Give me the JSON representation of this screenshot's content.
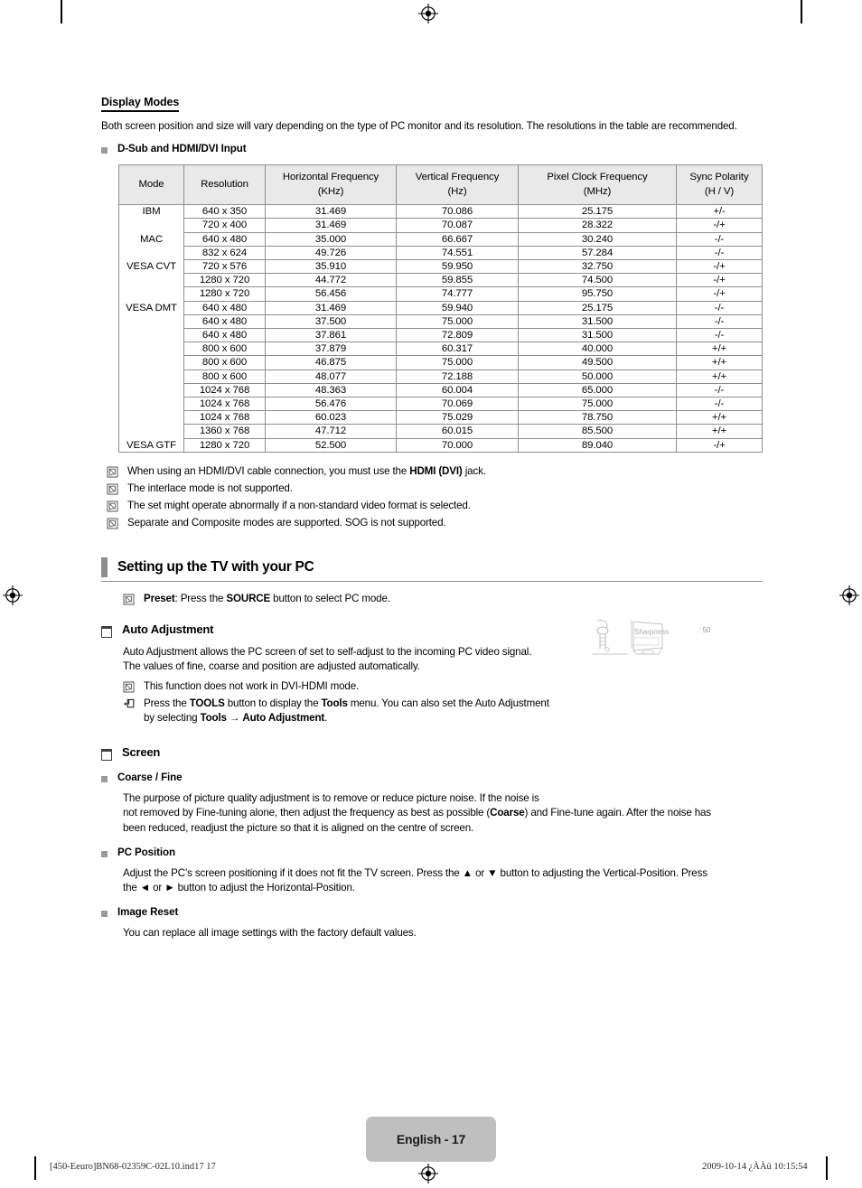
{
  "document": {
    "section_title": "Display Modes",
    "intro": "Both screen position and size will vary depending on the type of PC monitor and its resolution. The resolutions in the table are recommended.",
    "subsection_label": "D-Sub and HDMI/DVI Input"
  },
  "table": {
    "headers": [
      {
        "line1": "Mode",
        "line2": ""
      },
      {
        "line1": "Resolution",
        "line2": ""
      },
      {
        "line1": "Horizontal Frequency",
        "line2": "(KHz)"
      },
      {
        "line1": "Vertical Frequency",
        "line2": "(Hz)"
      },
      {
        "line1": "Pixel Clock Frequency",
        "line2": "(MHz)"
      },
      {
        "line1": "Sync Polarity",
        "line2": "(H / V)"
      }
    ],
    "rows": [
      {
        "mode": "IBM",
        "resolution": "640 x 350",
        "hfreq": "31.469",
        "vfreq": "70.086",
        "pclock": "25.175",
        "sync": "+/-",
        "group_start": true
      },
      {
        "mode": "",
        "resolution": "720 x 400",
        "hfreq": "31.469",
        "vfreq": "70.087",
        "pclock": "28.322",
        "sync": "-/+",
        "group_start": false
      },
      {
        "mode": "MAC",
        "resolution": "640 x 480",
        "hfreq": "35.000",
        "vfreq": "66.667",
        "pclock": "30.240",
        "sync": "-/-",
        "group_start": true
      },
      {
        "mode": "",
        "resolution": "832 x 624",
        "hfreq": "49.726",
        "vfreq": "74.551",
        "pclock": "57.284",
        "sync": "-/-",
        "group_start": false
      },
      {
        "mode": "VESA CVT",
        "resolution": "720 x 576",
        "hfreq": "35.910",
        "vfreq": "59.950",
        "pclock": "32.750",
        "sync": "-/+",
        "group_start": true
      },
      {
        "mode": "",
        "resolution": "1280 x 720",
        "hfreq": "44.772",
        "vfreq": "59.855",
        "pclock": "74.500",
        "sync": "-/+",
        "group_start": false
      },
      {
        "mode": "",
        "resolution": "1280 x 720",
        "hfreq": "56.456",
        "vfreq": "74.777",
        "pclock": "95.750",
        "sync": "-/+",
        "group_start": false
      },
      {
        "mode": "VESA DMT",
        "resolution": "640 x 480",
        "hfreq": "31.469",
        "vfreq": "59.940",
        "pclock": "25.175",
        "sync": "-/-",
        "group_start": true
      },
      {
        "mode": "",
        "resolution": "640 x 480",
        "hfreq": "37.500",
        "vfreq": "75.000",
        "pclock": "31.500",
        "sync": "-/-",
        "group_start": false
      },
      {
        "mode": "",
        "resolution": "640 x 480",
        "hfreq": "37.861",
        "vfreq": "72.809",
        "pclock": "31.500",
        "sync": "-/-",
        "group_start": false
      },
      {
        "mode": "",
        "resolution": "800 x 600",
        "hfreq": "37.879",
        "vfreq": "60.317",
        "pclock": "40.000",
        "sync": "+/+",
        "group_start": false
      },
      {
        "mode": "",
        "resolution": "800 x 600",
        "hfreq": "46.875",
        "vfreq": "75.000",
        "pclock": "49.500",
        "sync": "+/+",
        "group_start": false
      },
      {
        "mode": "",
        "resolution": "800 x 600",
        "hfreq": "48.077",
        "vfreq": "72.188",
        "pclock": "50.000",
        "sync": "+/+",
        "group_start": false
      },
      {
        "mode": "",
        "resolution": "1024 x 768",
        "hfreq": "48.363",
        "vfreq": "60.004",
        "pclock": "65.000",
        "sync": "-/-",
        "group_start": false
      },
      {
        "mode": "",
        "resolution": "1024 x 768",
        "hfreq": "56.476",
        "vfreq": "70.069",
        "pclock": "75.000",
        "sync": "-/-",
        "group_start": false
      },
      {
        "mode": "",
        "resolution": "1024 x 768",
        "hfreq": "60.023",
        "vfreq": "75.029",
        "pclock": "78.750",
        "sync": "+/+",
        "group_start": false
      },
      {
        "mode": "",
        "resolution": "1360 x 768",
        "hfreq": "47.712",
        "vfreq": "60.015",
        "pclock": "85.500",
        "sync": "+/+",
        "group_start": false
      },
      {
        "mode": "VESA GTF",
        "resolution": "1280 x 720",
        "hfreq": "52.500",
        "vfreq": "70.000",
        "pclock": "89.040",
        "sync": "-/+",
        "group_start": true
      }
    ]
  },
  "notes_after_table": [
    {
      "icon": "note-icon",
      "pre": "When using an HDMI/DVI cable connection, you must use the ",
      "bold": "HDMI (DVI)",
      "post": " jack."
    },
    {
      "icon": "note-icon",
      "pre": "The interlace mode is not supported.",
      "bold": "",
      "post": ""
    },
    {
      "icon": "note-icon",
      "pre": "The set might operate abnormally if a non-standard video format is selected.",
      "bold": "",
      "post": ""
    },
    {
      "icon": "note-icon",
      "pre": "Separate and Composite modes are supported. SOG is not supported.",
      "bold": "",
      "post": ""
    }
  ],
  "setup_section": {
    "title": "Setting up the TV with your PC",
    "preset_note": {
      "icon": "note-icon",
      "bold_lead": "Preset",
      "rest_pre": ": Press the ",
      "bold_mid": "SOURCE",
      "rest_post": " button to select PC mode."
    }
  },
  "auto_adjustment": {
    "heading": "Auto Adjustment",
    "body_line1": "Auto Adjustment allows the PC screen of set to self-adjust to the incoming PC video signal.",
    "body_line2": "The values of fine, coarse and position are adjusted automatically.",
    "note1": {
      "icon": "note-icon",
      "text": "This function does not work in DVI-HDMI mode."
    },
    "note2": {
      "icon": "tools-icon",
      "p1": "Press the ",
      "b1": "TOOLS",
      "p2": " button to display the ",
      "b2": "Tools",
      "p3": " menu. You can also set the Auto Adjustment",
      "p4": "by selecting ",
      "b3": "Tools",
      "p5": " → ",
      "b4": "Auto Adjustment",
      "p6": "."
    },
    "illustration": {
      "menu_label": "Sharpness",
      "menu_value": ": 50"
    }
  },
  "screen_section": {
    "heading": "Screen",
    "items": [
      {
        "label": "Coarse / Fine",
        "lines": [
          {
            "pre": "The purpose of picture quality adjustment is to remove or reduce picture noise. If the noise is",
            "bold": "",
            "post": ""
          },
          {
            "pre": "not removed by Fine-tuning alone, then adjust the frequency as best as possible (",
            "bold": "Coarse",
            "post": ") and Fine-tune again. After the noise has"
          },
          {
            "pre": "been reduced, readjust the picture so that it is aligned on the centre of screen.",
            "bold": "",
            "post": ""
          }
        ]
      },
      {
        "label": "PC Position",
        "lines": [
          {
            "pre": "Adjust the PC’s screen positioning if it does not fit the TV screen. Press the ▲ or ▼ button to adjusting the Vertical-Position. Press",
            "bold": "",
            "post": ""
          },
          {
            "pre": "the ◄ or ► button to adjust the Horizontal-Position.",
            "bold": "",
            "post": ""
          }
        ]
      },
      {
        "label": "Image Reset",
        "lines": [
          {
            "pre": "You can replace all image settings with the factory default values.",
            "bold": "",
            "post": ""
          }
        ]
      }
    ]
  },
  "footer": {
    "page_label": "English - 17",
    "file_mark": "[450-Eeuro]BN68-02359C-02L10.ind17   17",
    "timestamp": "2009-10-14   ¿ÀÀü 10:15:54"
  },
  "colors": {
    "bullet_square": "#9a9a9a",
    "section_bar": "#8d8d8d",
    "table_header_bg": "#e9e9e9",
    "table_border": "#8e8e8e",
    "page_badge_bg": "#bfbfbf"
  }
}
